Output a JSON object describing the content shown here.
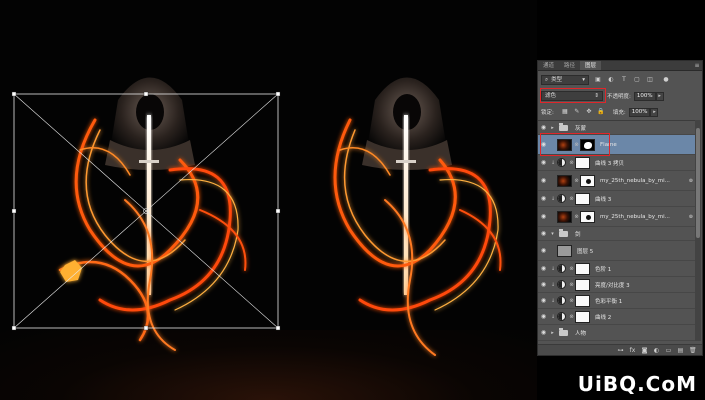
{
  "panel": {
    "tabs": [
      "通道",
      "路径",
      "图层"
    ],
    "active_tab": "图层",
    "menu_icon": "hamburger-menu-icon",
    "filter": {
      "value": "类型"
    },
    "blend": {
      "mode": "滤色",
      "opacity_label": "不透明度:",
      "opacity": "100%"
    },
    "lock": {
      "label": "锁定:",
      "fill_label": "填充:",
      "fill": "100%"
    },
    "layers": [
      {
        "name": "灰蒙",
        "kind": "group",
        "expanded": false
      },
      {
        "name": "Flame",
        "kind": "pixel-mask",
        "selected": true
      },
      {
        "name": "曲线 3 拷贝",
        "kind": "adjustment"
      },
      {
        "name": "my_25th_nebula_by_mi...",
        "kind": "pixel-mask",
        "fx": true
      },
      {
        "name": "曲线 3",
        "kind": "adjustment"
      },
      {
        "name": "my_25th_nebula_by_mi...",
        "kind": "pixel-mask",
        "fx": true
      },
      {
        "name": "剑",
        "kind": "group",
        "expanded": true
      },
      {
        "name": "图层 5",
        "kind": "pixel"
      },
      {
        "name": "色阶 1",
        "kind": "adjustment"
      },
      {
        "name": "亮度/对比度 3",
        "kind": "adjustment"
      },
      {
        "name": "色彩平衡 1",
        "kind": "adjustment"
      },
      {
        "name": "曲线 2",
        "kind": "adjustment"
      },
      {
        "name": "人物",
        "kind": "group",
        "expanded": false
      }
    ],
    "footer_icons": [
      "link-icon",
      "fx-icon",
      "mask-icon",
      "adjustment-icon",
      "folder-icon",
      "new-layer-icon",
      "trash-icon"
    ]
  },
  "colors": {
    "panel_bg": "#535353",
    "selected_row": "#6b87a8",
    "highlight": "#e0262a",
    "flame": "#ff6a1a"
  },
  "watermark": "UiBQ.CoM"
}
